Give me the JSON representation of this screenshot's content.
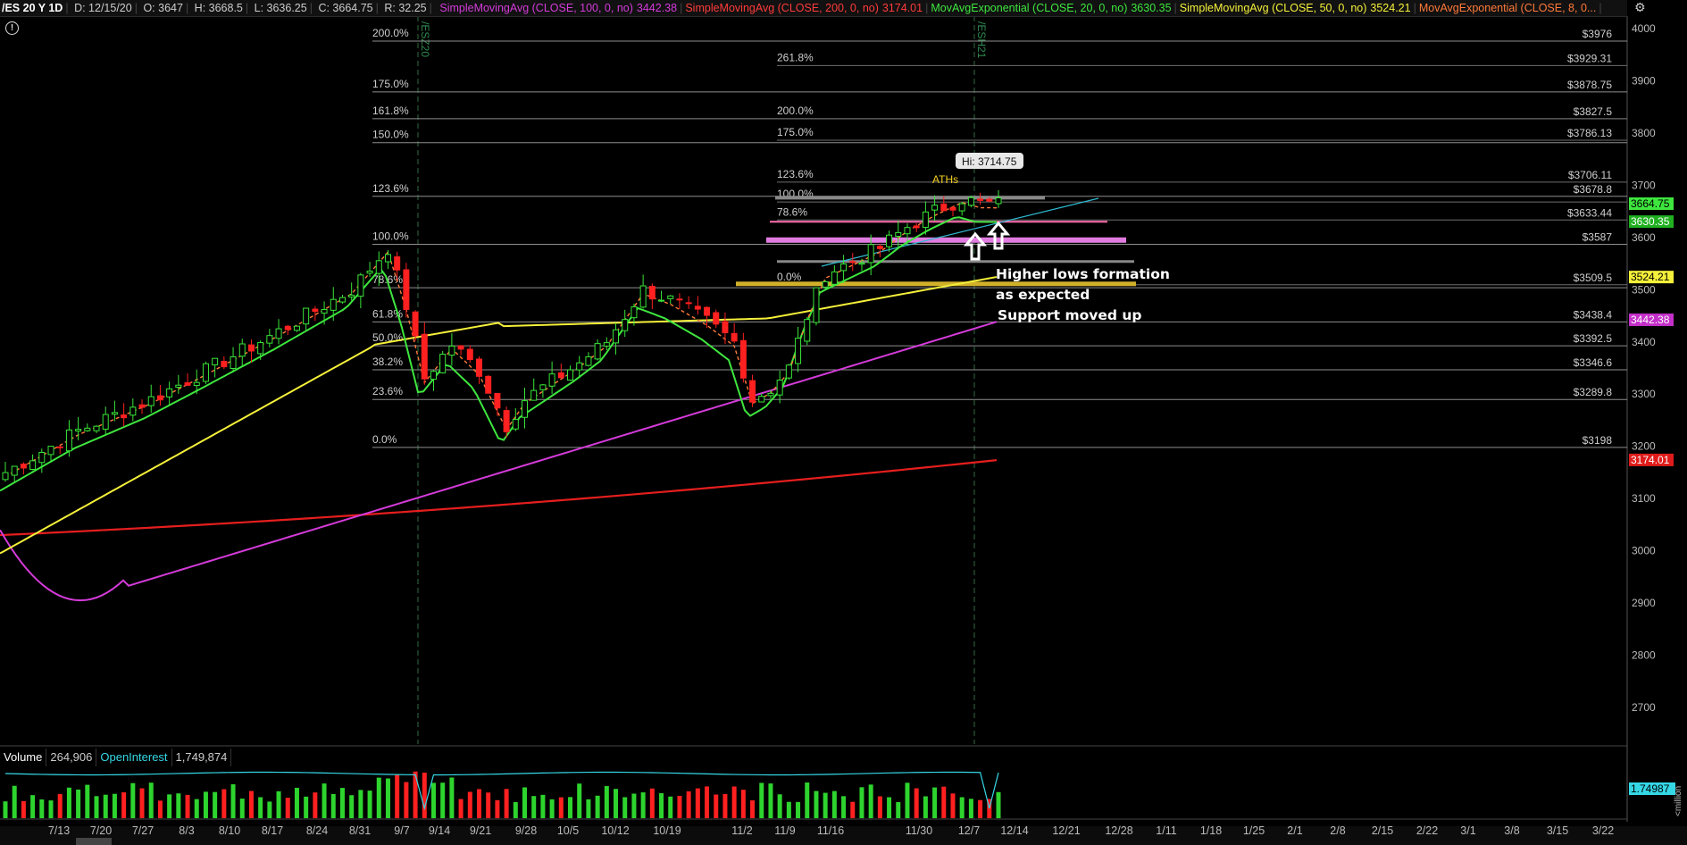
{
  "header": {
    "symbol": "/ES 20 Y 1D",
    "date": "D: 12/15/20",
    "open": "O: 3647",
    "high": "H: 3668.5",
    "low": "L: 3636.25",
    "close": "C: 3664.75",
    "range": "R: 32.25",
    "studies": [
      {
        "label": "SimpleMovingAvg (CLOSE, 100, 0, no)",
        "value": "3442.38",
        "color": "#d43bd9"
      },
      {
        "label": "SimpleMovingAvg (CLOSE, 200, 0, no)",
        "value": "3174.01",
        "color": "#ff3b3b"
      },
      {
        "label": "MovAvgExponential (CLOSE, 20, 0, no)",
        "value": "3630.35",
        "color": "#3ee63e"
      },
      {
        "label": "SimpleMovingAvg (CLOSE, 50, 0, no)",
        "value": "3524.21",
        "color": "#f5f03a"
      },
      {
        "label": "MovAvgExponential (CLOSE, 8, 0...",
        "value": "",
        "color": "#ff7a3a"
      }
    ]
  },
  "volume_pane": {
    "label": "Volume",
    "value": "264,906",
    "oi_label": "OpenInterest",
    "oi_value": "1,749,874",
    "axis_value": "1.74987",
    "axis_unit": "<million"
  },
  "expiry_markers": [
    "/ESZ20",
    "/ESH21"
  ],
  "annotations": {
    "aths": "ATHs",
    "hi_label": "Hi: 3714.75",
    "text_line1": "Higher lows formation",
    "text_line2": "as expected",
    "text_line3": "Support moved up"
  },
  "chart_data": {
    "type": "candlestick",
    "price_axis": {
      "ticks": [
        4000,
        3900,
        3800,
        3700,
        3600,
        3500,
        3400,
        3300,
        3200,
        3100,
        3000,
        2900,
        2800,
        2700
      ],
      "range": [
        2630,
        4020
      ]
    },
    "x_axis": {
      "labels": [
        "7/13",
        "7/20",
        "7/27",
        "8/3",
        "8/10",
        "8/17",
        "8/24",
        "8/31",
        "9/7",
        "9/14",
        "9/21",
        "9/28",
        "10/5",
        "10/12",
        "10/19",
        "11/2",
        "11/9",
        "11/16",
        "11/30",
        "12/7",
        "12/14",
        "12/21",
        "12/28",
        "1/11",
        "1/18",
        "1/25",
        "2/1",
        "2/8",
        "2/15",
        "2/22",
        "3/1",
        "3/8",
        "3/15",
        "3/22"
      ]
    },
    "fib_left": [
      {
        "label": "200.0%",
        "price": 3976
      },
      {
        "label": "175.0%",
        "price": 3878.75
      },
      {
        "label": "161.8%",
        "price": 3827.5
      },
      {
        "label": "150.0%",
        "price": 3781.5
      },
      {
        "label": "123.6%",
        "price": 3678.8
      },
      {
        "label": "100.0%",
        "price": 3587
      },
      {
        "label": "78.6%",
        "price": 3503.8
      },
      {
        "label": "61.8%",
        "price": 3438.4
      },
      {
        "label": "50.0%",
        "price": 3392.5
      },
      {
        "label": "38.2%",
        "price": 3346.6
      },
      {
        "label": "23.6%",
        "price": 3289.8
      },
      {
        "label": "0.0%",
        "price": 3198
      }
    ],
    "fib_right": [
      {
        "label": "261.8%",
        "price": 3929.31
      },
      {
        "label": "200.0%",
        "price": 3827.5
      },
      {
        "label": "175.0%",
        "price": 3786.13
      },
      {
        "label": "123.6%",
        "price": 3706.11
      },
      {
        "label": "100.0%",
        "price": 3668
      },
      {
        "label": "78.6%",
        "price": 3633.44
      },
      {
        "label": "0.0%",
        "price": 3509.5
      }
    ],
    "level_labels": [
      {
        "text": "$3976",
        "price": 3976
      },
      {
        "text": "$3929.31",
        "price": 3929.31
      },
      {
        "text": "$3878.75",
        "price": 3878.75
      },
      {
        "text": "$3827.5",
        "price": 3827.5
      },
      {
        "text": "$3786.13",
        "price": 3786.13
      },
      {
        "text": "$3706.11",
        "price": 3706.11
      },
      {
        "text": "$3678.8",
        "price": 3678.8
      },
      {
        "text": "$3633.44",
        "price": 3633.44
      },
      {
        "text": "$3587",
        "price": 3587
      },
      {
        "text": "$3509.5",
        "price": 3509.5
      },
      {
        "text": "$3438.4",
        "price": 3438.4
      },
      {
        "text": "$3392.5",
        "price": 3392.5
      },
      {
        "text": "$3346.6",
        "price": 3346.6
      },
      {
        "text": "$3289.8",
        "price": 3289.8
      },
      {
        "text": "$3198",
        "price": 3198
      }
    ],
    "price_tags": [
      {
        "text": "3664.75",
        "price": 3664.75,
        "color": "#3ee63e",
        "fg": "#000"
      },
      {
        "text": "3630.35",
        "price": 3630.35,
        "color": "#20b020",
        "fg": "#fff"
      },
      {
        "text": "3524.21",
        "price": 3524.21,
        "color": "#f5f03a",
        "fg": "#000"
      },
      {
        "text": "3442.38",
        "price": 3442.38,
        "color": "#c42fc9",
        "fg": "#fff"
      },
      {
        "text": "3174.01",
        "price": 3174.01,
        "color": "#e01b1b",
        "fg": "#fff"
      }
    ],
    "series": [
      {
        "name": "SMA 200",
        "color": "#ff2222",
        "start": 3030,
        "end": 3174
      },
      {
        "name": "SMA 100",
        "color": "#d43bd9",
        "start": 2905,
        "end": 3442
      },
      {
        "name": "SMA 50",
        "color": "#f5f03a",
        "start": 3000,
        "end": 3524
      },
      {
        "name": "EMA 20",
        "color": "#3ee63e",
        "start": 3080,
        "end": 3630
      }
    ],
    "colors": {
      "up": "#39e639",
      "down": "#ff2020",
      "grid": "#333333",
      "fib": "#9a9a9a"
    }
  }
}
